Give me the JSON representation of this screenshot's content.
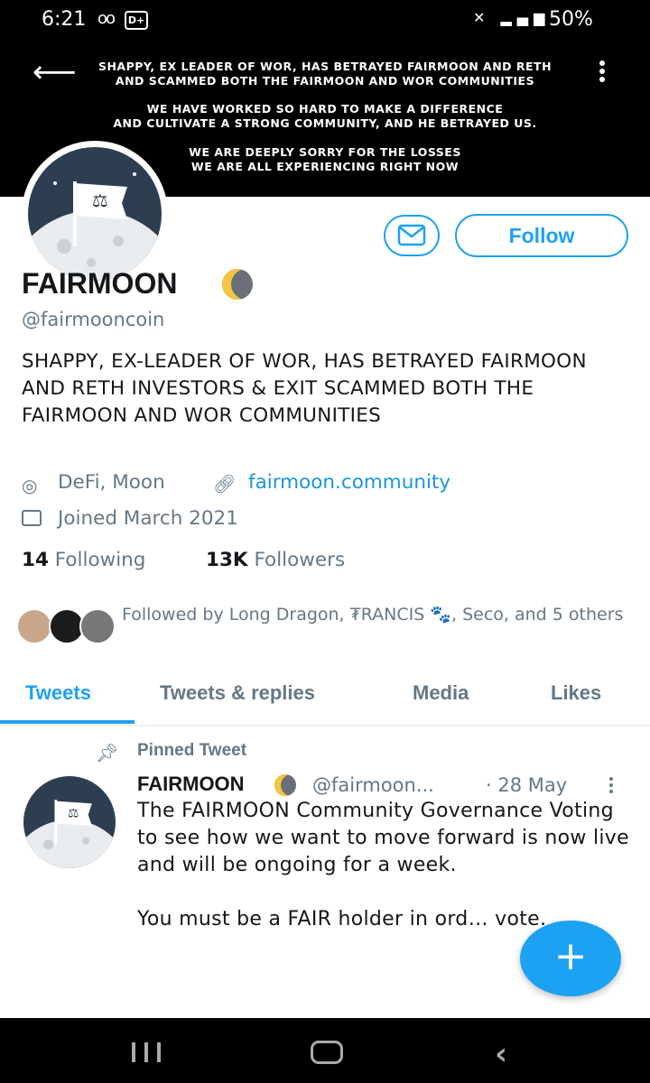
{
  "status_bar": {
    "time": "6:21",
    "voicemail": "oo",
    "app_badge": "D+",
    "battery": "50%"
  },
  "banner": {
    "line1": "SHAPPY, EX LEADER OF WOR, HAS BETRAYED FAIRMOON AND RETH",
    "line2": "AND SCAMMED BOTH THE FAIRMOON AND WOR COMMUNITIES",
    "line3": "WE HAVE WORKED SO HARD TO MAKE A DIFFERENCE",
    "line4": "AND CULTIVATE A STRONG COMMUNITY, AND HE BETRAYED US.",
    "line5": "WE ARE DEEPLY SORRY FOR THE LOSSES",
    "line6": "WE ARE ALL EXPERIENCING RIGHT NOW"
  },
  "profile": {
    "follow_label": "Follow",
    "display_name": "FAIRMOON",
    "handle": "@fairmooncoin",
    "bio": "SHAPPY, EX-LEADER OF WOR, HAS BETRAYED FAIRMOON AND RETH INVESTORS & EXIT SCAMMED BOTH THE FAIRMOON AND WOR COMMUNITIES",
    "location": "DeFi, Moon",
    "website": "fairmoon.community",
    "joined": "Joined March 2021",
    "following_count": "14",
    "following_label": "Following",
    "followers_count": "13K",
    "followers_label": "Followers",
    "followed_by": "Followed by Long Dragon, ₮RANCIS 🐾, Seco, and 5 others"
  },
  "tabs": {
    "tweets": "Tweets",
    "replies": "Tweets & replies",
    "media": "Media",
    "likes": "Likes"
  },
  "tweet": {
    "pinned_label": "Pinned Tweet",
    "name": "FAIRMOON",
    "handle": "@fairmoon...",
    "date": "· 28 May",
    "text": "The FAIRMOON Community Governance Voting to see how we want to move forward is now live and will be ongoing for a week.\n\nYou must be a FAIR holder in ord… vote."
  },
  "colors": {
    "accent": "#1da1f2",
    "link": "#1b95e0",
    "muted": "#657786"
  }
}
